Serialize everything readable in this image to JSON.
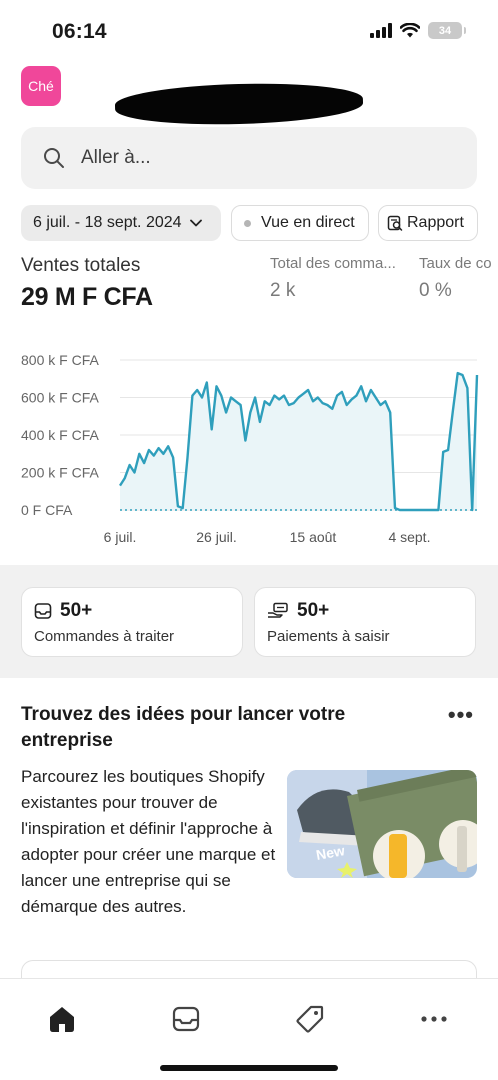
{
  "status_bar": {
    "time": "06:14",
    "battery": "34"
  },
  "store": {
    "avatar_initials": "Ché"
  },
  "search": {
    "placeholder": "Aller à..."
  },
  "filters": {
    "date_range": "6 juil. - 18 sept. 2024",
    "live_view": "Vue en direct",
    "report": "Rapport"
  },
  "metrics": [
    {
      "label": "Ventes totales",
      "value": "29 M F CFA"
    },
    {
      "label": "Total des comma...",
      "value": "2 k"
    },
    {
      "label": "Taux de co",
      "value": "0 %"
    }
  ],
  "chart_data": {
    "type": "line",
    "y_tick_labels": [
      "800 k F CFA",
      "600 k F CFA",
      "400 k F CFA",
      "200 k F CFA",
      "0 F CFA"
    ],
    "y_ticks": [
      800000,
      600000,
      400000,
      200000,
      0
    ],
    "x_tick_labels": [
      "6 juil.",
      "26 juil.",
      "15 août",
      "4 sept."
    ],
    "ylim": [
      0,
      800000
    ],
    "x_range": [
      "2024-07-06",
      "2024-09-18"
    ],
    "grid": true,
    "color": "#2f9fbc",
    "series": [
      {
        "x": [
          "2024-07-06",
          "2024-07-07",
          "2024-07-08",
          "2024-07-09",
          "2024-07-10",
          "2024-07-11",
          "2024-07-12",
          "2024-07-13",
          "2024-07-14",
          "2024-07-15",
          "2024-07-16",
          "2024-07-17",
          "2024-07-18",
          "2024-07-19",
          "2024-07-20",
          "2024-07-21",
          "2024-07-22",
          "2024-07-23",
          "2024-07-24",
          "2024-07-25",
          "2024-07-26",
          "2024-07-27",
          "2024-07-28",
          "2024-07-29",
          "2024-07-30",
          "2024-07-31",
          "2024-08-01",
          "2024-08-02",
          "2024-08-03",
          "2024-08-04",
          "2024-08-05",
          "2024-08-06",
          "2024-08-07",
          "2024-08-08",
          "2024-08-09",
          "2024-08-10",
          "2024-08-11",
          "2024-08-12",
          "2024-08-13",
          "2024-08-14",
          "2024-08-15",
          "2024-08-16",
          "2024-08-17",
          "2024-08-18",
          "2024-08-19",
          "2024-08-20",
          "2024-08-21",
          "2024-08-22",
          "2024-08-23",
          "2024-08-24",
          "2024-08-25",
          "2024-08-26",
          "2024-08-27",
          "2024-08-28",
          "2024-08-29",
          "2024-08-30",
          "2024-08-31",
          "2024-09-01",
          "2024-09-02",
          "2024-09-03",
          "2024-09-04",
          "2024-09-05",
          "2024-09-06",
          "2024-09-07",
          "2024-09-08",
          "2024-09-09",
          "2024-09-10",
          "2024-09-11",
          "2024-09-12",
          "2024-09-13",
          "2024-09-14",
          "2024-09-15",
          "2024-09-16",
          "2024-09-17",
          "2024-09-18"
        ],
        "values": [
          130000,
          170000,
          240000,
          200000,
          300000,
          250000,
          320000,
          290000,
          330000,
          300000,
          340000,
          280000,
          20000,
          10000,
          280000,
          610000,
          640000,
          600000,
          680000,
          430000,
          660000,
          610000,
          520000,
          600000,
          580000,
          560000,
          370000,
          520000,
          600000,
          470000,
          580000,
          560000,
          610000,
          590000,
          610000,
          560000,
          570000,
          600000,
          620000,
          640000,
          580000,
          600000,
          570000,
          560000,
          540000,
          610000,
          630000,
          560000,
          590000,
          610000,
          660000,
          580000,
          640000,
          600000,
          560000,
          580000,
          520000,
          10000,
          0,
          0,
          0,
          0,
          0,
          0,
          0,
          0,
          0,
          310000,
          320000,
          530000,
          730000,
          720000,
          650000,
          0,
          720000
        ]
      }
    ]
  },
  "summary": [
    {
      "count": "50+",
      "label": "Commandes à traiter"
    },
    {
      "count": "50+",
      "label": "Paiements à saisir"
    }
  ],
  "ideas": {
    "title": "Trouvez des idées pour lancer votre entreprise",
    "body": "Parcourez les boutiques Shopify existantes pour trouver de l'inspiration et définir l'approche à adopter pour créer une marque et lancer une entreprise qui se démarque des autres.",
    "image_text": "New"
  }
}
